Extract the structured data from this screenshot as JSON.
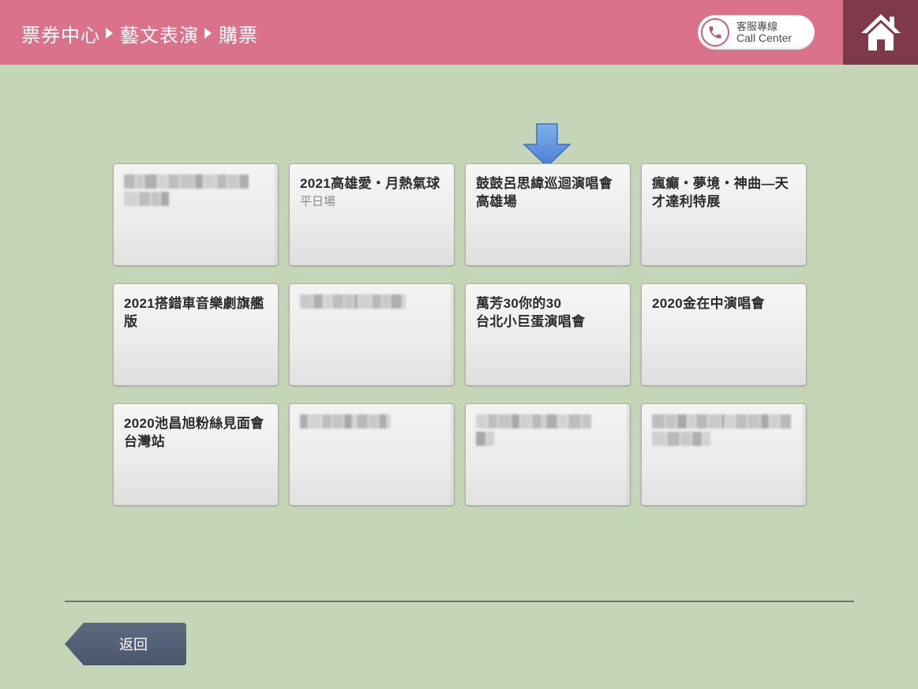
{
  "header": {
    "breadcrumb": [
      "票券中心",
      "藝文表演",
      "購票"
    ],
    "call_center": {
      "zh": "客服專線",
      "en": "Call Center"
    },
    "home_icon": "house-icon",
    "phone_icon": "phone-icon"
  },
  "colors": {
    "header": "#d9728a",
    "home": "#7e3a4c",
    "background": "#c5d5b8",
    "arrow": "#5b8fd8",
    "back_button": "#4f5a6e"
  },
  "pointer_icon": "arrow-down-icon",
  "events": [
    {
      "title": "",
      "subtitle": "",
      "obscured": true
    },
    {
      "title": "2021高雄愛・月熱氣球",
      "subtitle": "平日場",
      "obscured": false
    },
    {
      "title": "鼓鼓呂思緯巡迴演唱會高雄場",
      "subtitle": "",
      "obscured": false
    },
    {
      "title": "瘋癲・夢境・神曲—天才達利特展",
      "subtitle": "",
      "obscured": false
    },
    {
      "title": "2021搭錯車音樂劇旗艦版",
      "subtitle": "",
      "obscured": false
    },
    {
      "title": "",
      "subtitle": "",
      "obscured": true
    },
    {
      "title": "萬芳30你的30\n台北小巨蛋演唱會",
      "subtitle": "",
      "obscured": false
    },
    {
      "title": "2020金在中演唱會",
      "subtitle": "",
      "obscured": false
    },
    {
      "title": "2020池昌旭粉絲見面會　台灣站",
      "subtitle": "",
      "obscured": false
    },
    {
      "title": "",
      "subtitle": "",
      "obscured": true
    },
    {
      "title": "",
      "subtitle": "",
      "obscured": true
    },
    {
      "title": "",
      "subtitle": "",
      "obscured": true
    }
  ],
  "footer": {
    "back_label": "返回"
  }
}
